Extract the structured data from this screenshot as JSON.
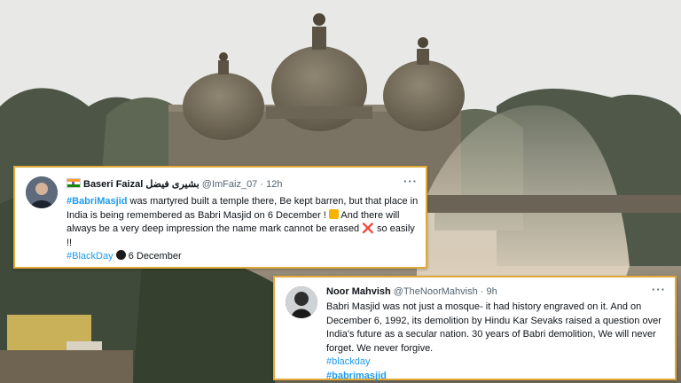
{
  "tweets": [
    {
      "flag": "india-flag",
      "name": "Baseri Faizal",
      "name_urdu": "بشیری فیضل",
      "handle": "@ImFaiz_07",
      "time": "12h",
      "more_icon": "···",
      "hashtag_lead": "#BabriMasjid",
      "text1": " was martyred built a temple there, Be kept barren, but that place in India is being remembered as Babri Masjid on 6 December ! ",
      "text2": " And there will always be a very deep impression the name mark cannot be erased ",
      "cross_symbol": "❌",
      "text3": " so easily !!",
      "hashtag_end": "#BlackDay",
      "end_text": " 6 December"
    },
    {
      "name": "Noor Mahvish",
      "handle": "@TheNoorMahvish",
      "time": "9h",
      "more_icon": "···",
      "text": "Babri Masjid was not just a mosque- it had history engraved on it. And on December 6, 1992, its demolition by Hindu Kar Sevaks raised a question over India's future as a secular nation. 30 years of Babri demolition, We will never forget. We never forgive.",
      "hashtag1": "#blackday",
      "hashtag2": "#babrimasjid"
    }
  ],
  "colors": {
    "card_border": "#e0a93a",
    "link": "#1d9bf0",
    "muted": "#536471"
  }
}
